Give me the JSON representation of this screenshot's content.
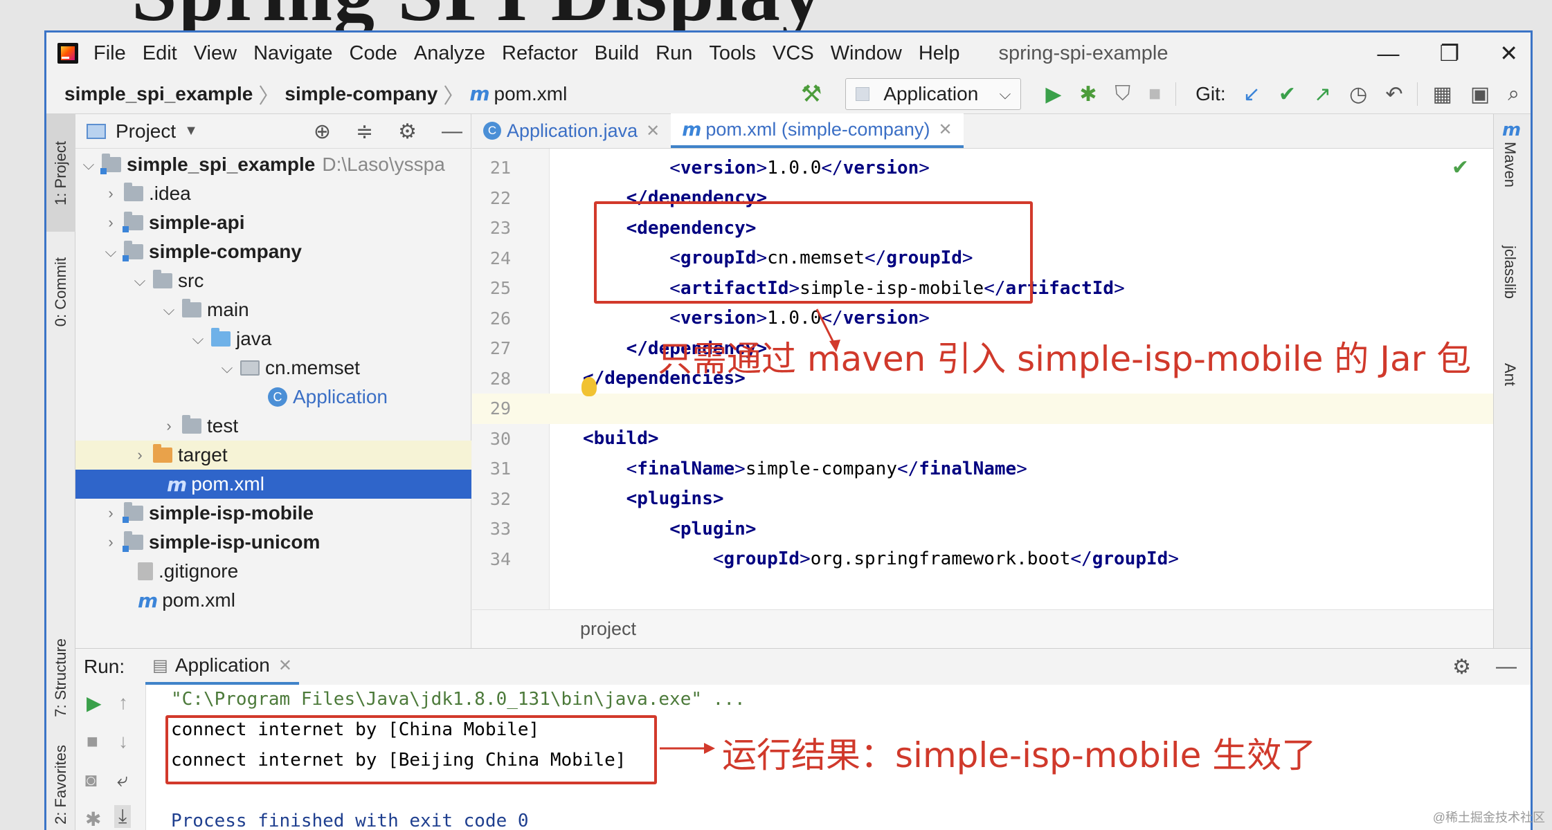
{
  "slide_title": "Spring SPI Display",
  "menubar": {
    "items": [
      "File",
      "Edit",
      "View",
      "Navigate",
      "Code",
      "Analyze",
      "Refactor",
      "Build",
      "Run",
      "Tools",
      "VCS",
      "Window",
      "Help"
    ],
    "window_title": "spring-spi-example",
    "minimize": "—",
    "restore": "❐",
    "close": "✕"
  },
  "navbar": {
    "crumbs": [
      "simple_spi_example",
      "simple-company"
    ],
    "file": "pom.xml",
    "run_config": "Application",
    "git_label": "Git:"
  },
  "left_strip": {
    "project_tab": "1: Project",
    "commit_tab": "0: Commit",
    "structure_tab": "7: Structure",
    "favorites_tab": "2: Favorites"
  },
  "project": {
    "title": "Project",
    "tree": [
      {
        "label": "simple_spi_example",
        "extra": "D:\\Laso\\ysspa"
      },
      {
        "label": ".idea"
      },
      {
        "label": "simple-api"
      },
      {
        "label": "simple-company"
      },
      {
        "label": "src"
      },
      {
        "label": "main"
      },
      {
        "label": "java"
      },
      {
        "label": "cn.memset"
      },
      {
        "label": "Application"
      },
      {
        "label": "test"
      },
      {
        "label": "target"
      },
      {
        "label": "pom.xml"
      },
      {
        "label": "simple-isp-mobile"
      },
      {
        "label": "simple-isp-unicom"
      },
      {
        "label": ".gitignore"
      },
      {
        "label": "pom.xml"
      }
    ]
  },
  "editor": {
    "tabs": [
      {
        "label": "Application.java"
      },
      {
        "label": "pom.xml (simple-company)"
      }
    ],
    "lines": [
      {
        "num": "21",
        "indent": "        ",
        "open": "version",
        "text": "1.0.0",
        "close": "version"
      },
      {
        "num": "22",
        "indent": "    ",
        "open": "",
        "text": "</dependency>",
        "close": ""
      },
      {
        "num": "23",
        "indent": "    ",
        "open": "",
        "text": "<dependency>",
        "close": ""
      },
      {
        "num": "24",
        "indent": "        ",
        "open": "groupId",
        "text": "cn.memset",
        "close": "groupId"
      },
      {
        "num": "25",
        "indent": "        ",
        "open": "artifactId",
        "text": "simple-isp-mobile",
        "close": "artifactId"
      },
      {
        "num": "26",
        "indent": "        ",
        "open": "version",
        "text": "1.0.0",
        "close": "version"
      },
      {
        "num": "27",
        "indent": "    ",
        "open": "",
        "text": "</dependency>",
        "close": ""
      },
      {
        "num": "28",
        "indent": "",
        "open": "",
        "text": "</dependencies>",
        "close": ""
      },
      {
        "num": "29",
        "indent": "",
        "open": "",
        "text": "",
        "close": ""
      },
      {
        "num": "30",
        "indent": "",
        "open": "",
        "text": "<build>",
        "close": ""
      },
      {
        "num": "31",
        "indent": "    ",
        "open": "finalName",
        "text": "simple-company",
        "close": "finalName"
      },
      {
        "num": "32",
        "indent": "    ",
        "open": "",
        "text": "<plugins>",
        "close": ""
      },
      {
        "num": "33",
        "indent": "        ",
        "open": "",
        "text": "<plugin>",
        "close": ""
      },
      {
        "num": "34",
        "indent": "            ",
        "open": "groupId",
        "text": "org.springframework.boot",
        "close": "groupId"
      }
    ],
    "breadcrumb": "project",
    "annotation": "只需通过 maven 引入 simple-isp-mobile 的 Jar 包"
  },
  "right_strip": {
    "maven": "Maven",
    "jclasslib": "jclasslib",
    "ant": "Ant"
  },
  "run": {
    "label": "Run:",
    "tab": "Application",
    "console": [
      "\"C:\\Program Files\\Java\\jdk1.8.0_131\\bin\\java.exe\" ...",
      "connect internet by [China Mobile]",
      "connect internet by [Beijing China Mobile]",
      "",
      "Process finished with exit code 0"
    ],
    "annotation": "运行结果：simple-isp-mobile 生效了"
  },
  "watermark": "@稀土掘金技术社区",
  "colors": {
    "accent": "#3b74c6",
    "annotation": "#d2392b",
    "selection": "#2f65ca"
  }
}
